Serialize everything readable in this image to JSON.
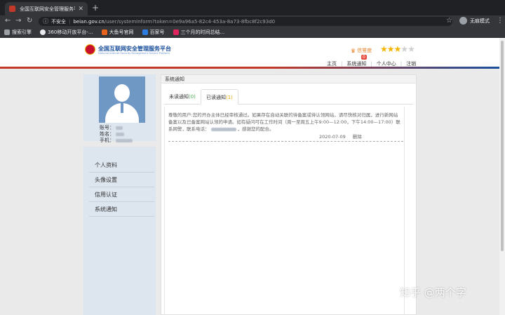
{
  "browser": {
    "tab_title": "全国互联网安全管理服务平台",
    "insecure_label": "不安全",
    "url_host": "beian.gov.cn",
    "url_path": "/user/systemInform?token=0e9a96a5-82c4-453a-8a73-8fbc8f2c93d0",
    "profile_label": "无痕模式",
    "bookmarks": [
      "搜索引擎",
      "360移动开放平台-...",
      "大鱼号官网",
      "百家号",
      "三个月的时间总结..."
    ]
  },
  "site": {
    "title": "全国互联网安全管理服务平台",
    "subtitle": "National Internet Security Management Service Platform",
    "credit_label": "信誉度",
    "credit_count": "0",
    "star_rating": 3,
    "star_total": 5,
    "nav": [
      "主页",
      "系统通知",
      "个人中心",
      "注销"
    ]
  },
  "profile": {
    "account_label": "账号：",
    "name_label": "姓名：",
    "phone_label": "手机："
  },
  "menu": [
    "个人资料",
    "头像设置",
    "信用认证",
    "系统通知"
  ],
  "content": {
    "title": "系统通知",
    "tab_unread_label": "未读通知",
    "tab_unread_count": "(0)",
    "tab_read_label": "已读通知",
    "tab_read_count": "(1)",
    "message_part1": "尊敬的用户:您的开办主体已经审核通过。如果存在自动关联的待备案或待认领网站，请尽快核对归属，进行新网站备案以及已备案网站认领的申请。如有疑问可在工作时间（周一至周五上午9:00—12:00，下午14:00—17:00）联系网警，联系电话：",
    "message_part2": "，感谢您的配合。",
    "message_date": "2020-07-09",
    "delete_label": "删除"
  },
  "watermark": "知乎 @两个字",
  "colors": {
    "accent_red": "#c0392b",
    "brand_blue": "#1a4f9c",
    "star_gold": "#f5b400",
    "credit_orange": "#e67e22"
  }
}
